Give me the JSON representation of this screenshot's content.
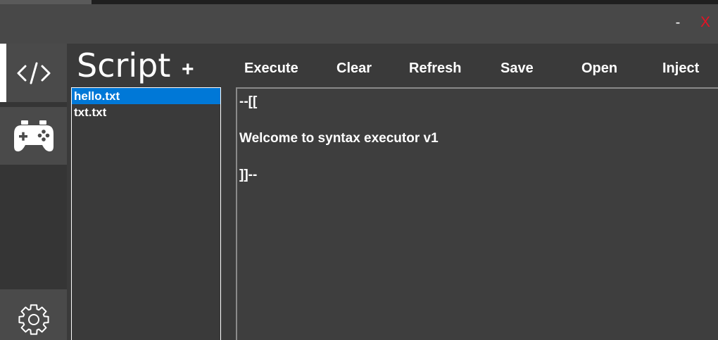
{
  "window": {
    "minimize_label": "-",
    "close_label": "X"
  },
  "sidebar": {
    "items": [
      {
        "icon": "code-icon",
        "active": true
      },
      {
        "icon": "gamepad-icon",
        "active": false
      },
      {
        "icon": "gear-icon",
        "active": false
      }
    ]
  },
  "main": {
    "title": "Script",
    "add_label": "+",
    "toolbar": {
      "execute": "Execute",
      "clear": "Clear",
      "refresh": "Refresh",
      "save": "Save",
      "open": "Open",
      "inject": "Inject"
    },
    "files": [
      {
        "name": "hello.txt",
        "selected": true
      },
      {
        "name": "txt.txt",
        "selected": false
      }
    ],
    "editor_lines": [
      "--[[",
      "",
      "Welcome to syntax executor v1",
      "",
      "]]--"
    ]
  },
  "colors": {
    "accent": "#0078d7",
    "close": "#e81123",
    "background": "#3a3a3a",
    "titlebar": "#484848"
  }
}
